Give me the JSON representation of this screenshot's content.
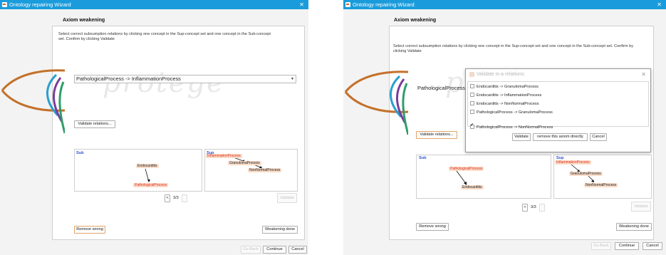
{
  "window": {
    "title": "Ontology repairing Wizard",
    "close_glyph": "✕"
  },
  "left": {
    "heading": "Axiom weakening",
    "instructions": "Select correct subsumption relations by clicking one concept in the Sup-concept set and one concept in the Sub-concept set. Confirm by clicking Validate",
    "axiom_combo": "PathologicalProcess -> InflammationProcess",
    "validate_relations": "Validate relations...",
    "sub_label": "Sub",
    "sup_label": "Sup",
    "sub_nodes": [
      "Endocarditis",
      "PathologicalProcess"
    ],
    "sup_nodes": [
      "InflammationProcess",
      "GranulomaProcess",
      "NonNormalProcess"
    ],
    "pager_prev": "<",
    "pager_text": "3/3",
    "validate": "Validate",
    "remove_wrong": "Remove wrong",
    "weakening_done": "Weakening done",
    "go_back": "Go Back",
    "continue": "Continue",
    "cancel": "Cancel"
  },
  "right": {
    "heading": "Axiom weakening",
    "instructions": "Select correct subsumption relations by clicking one concept in the Sup-concept set and one concept in the Sub-concept set. Confirm by clicking Validate",
    "axiom_combo": "PathologicalProcess -",
    "validate_relations": "Validate relations...",
    "sub_label": "Sub",
    "sup_label": "Sup",
    "sub_nodes": [
      "PathologicalProcess",
      "Endocarditis"
    ],
    "sup_nodes": [
      "InflammationProcess",
      "GranulomaProcess",
      "NonNormalProcess"
    ],
    "pager_prev": "<",
    "pager_text": "3/3",
    "validate": "Validate",
    "remove_wrong": "Remove wrong",
    "weakening_done": "Weakening done",
    "go_back": "Go Back",
    "continue": "Continue",
    "cancel": "Cancel"
  },
  "dialog": {
    "title": "Validate is-a relations:",
    "items": [
      {
        "label": "Endocarditis -> GranulomaProcess",
        "checked": false
      },
      {
        "label": "Endocarditis -> InflammationProcess",
        "checked": false
      },
      {
        "label": "Endocarditis -> NonNormalProcess",
        "checked": false
      },
      {
        "label": "PathologicalProcess -> GranulomaProcess",
        "checked": false
      },
      {
        "label": "PathologicalProcess -> NonNormalProcess",
        "checked": true
      }
    ],
    "validate": "Validate",
    "remove_directly": "remove this axiom directly",
    "cancel": "Cancel"
  },
  "colors": {
    "titlebar": "#1a9cdc",
    "node_fill": "#f9dcc8",
    "node_red": "#e0301e",
    "graph_label": "#2f52d7",
    "focus_border": "#e3a46a"
  }
}
